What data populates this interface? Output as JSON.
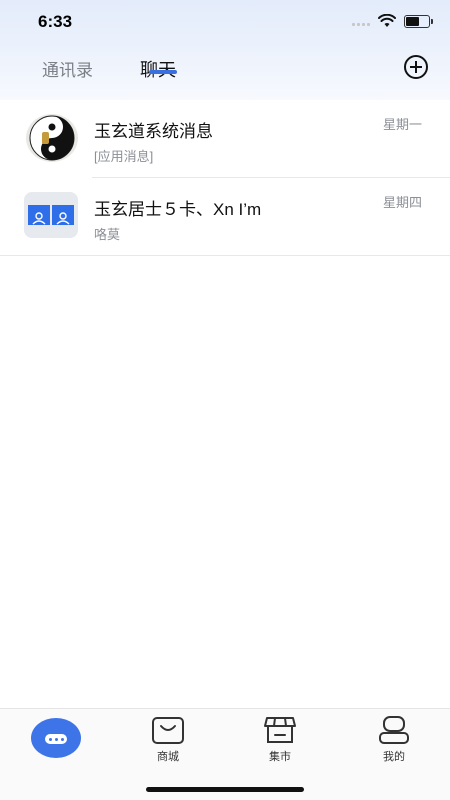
{
  "status_bar": {
    "time": "6:33"
  },
  "header": {
    "tabs": [
      {
        "label": "通讯录",
        "active": false
      },
      {
        "label": "聊天",
        "active": true
      }
    ],
    "add_icon": "add-circle-icon",
    "accent_color": "#3a6fe0"
  },
  "conversations": [
    {
      "name": "玉玄道系统消息",
      "preview": "[应用消息]",
      "date": "星期一",
      "avatar": "yin-yang-avatar"
    },
    {
      "name": "玉玄居士５卡、Xn I’m",
      "preview": "咯莫",
      "date": "星期四",
      "avatar": "group-avatar"
    }
  ],
  "bottom_nav": {
    "items": [
      {
        "label": "",
        "icon": "chat-icon",
        "active": true
      },
      {
        "label": "商城",
        "icon": "shopping-bag-icon",
        "active": false
      },
      {
        "label": "集市",
        "icon": "store-icon",
        "active": false
      },
      {
        "label": "我的",
        "icon": "profile-icon",
        "active": false
      }
    ]
  }
}
